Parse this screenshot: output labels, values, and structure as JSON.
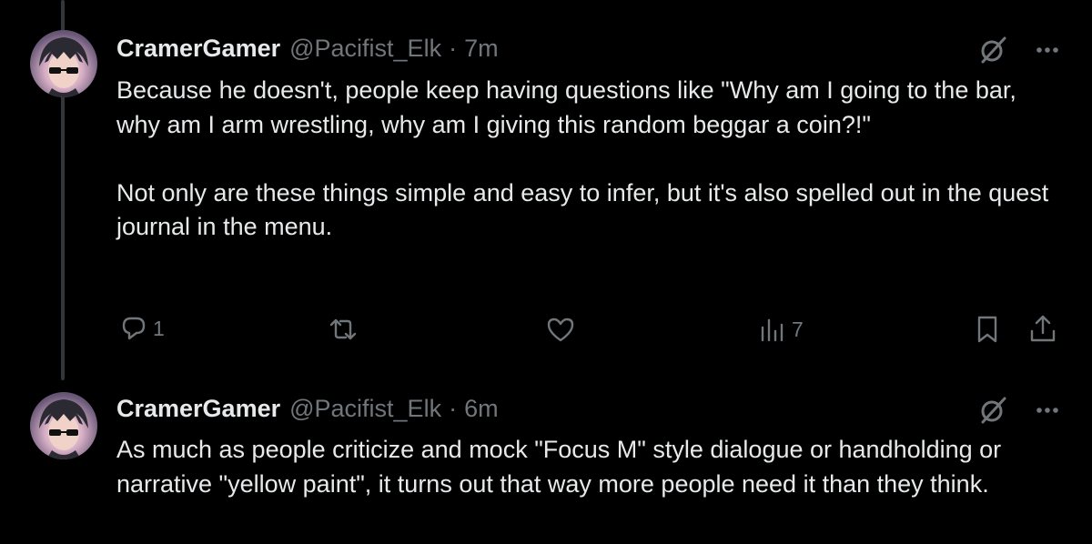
{
  "tweets": [
    {
      "display_name": "CramerGamer",
      "handle": "@Pacifist_Elk",
      "separator": "·",
      "time": "7m",
      "text": "Because he doesn't, people keep having questions like \"Why am I going to the bar, why am I arm wrestling, why am I giving this random beggar a coin?!\"\n\nNot only are these things simple and easy to infer, but it's also spelled out in the quest journal in the menu.",
      "actions": {
        "reply_count": "1",
        "views_count": "7"
      }
    },
    {
      "display_name": "CramerGamer",
      "handle": "@Pacifist_Elk",
      "separator": "·",
      "time": "6m",
      "text": "As much as people criticize and mock \"Focus M\" style dialogue or handholding or narrative \"yellow paint\", it turns out that way more people need it than they think."
    }
  ],
  "icons": {
    "grok": "grok-icon",
    "more": "more-icon",
    "reply": "reply-icon",
    "retweet": "retweet-icon",
    "like": "like-icon",
    "views": "views-icon",
    "bookmark": "bookmark-icon",
    "share": "share-icon"
  },
  "colors": {
    "background": "#000000",
    "primary_text": "#e7e9ea",
    "secondary_text": "#71767b",
    "thread_line": "#333639"
  }
}
